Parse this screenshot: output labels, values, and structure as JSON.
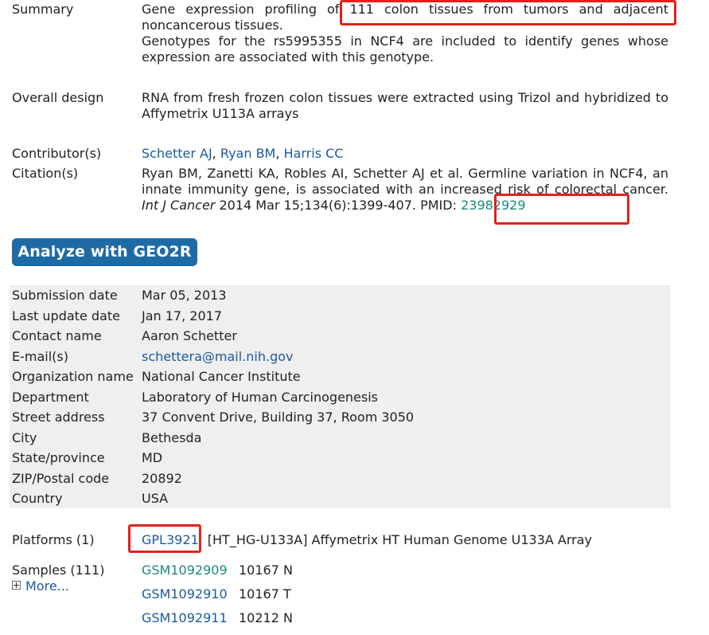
{
  "summary": {
    "label": "Summary",
    "line1_before": "Gene expression profiling of",
    "line1_highlight": "111 colon tissues from tumors and adjacent",
    "line1_after": "noncancerous tissues.",
    "line2": "Genotypes for the rs5995355 in NCF4 are included to identify genes whose expression are associated with this genotype."
  },
  "overall_design": {
    "label": "Overall design",
    "text": "RNA from fresh frozen colon tissues were extracted using Trizol and hybridized to Affymetrix U113A arrays"
  },
  "contributors": {
    "label": "Contributor(s)",
    "names": [
      "Schetter AJ",
      "Ryan BM",
      "Harris CC"
    ],
    "separator": ", "
  },
  "citation": {
    "label": "Citation(s)",
    "text_before": "Ryan BM, Zanetti KA, Robles AI, Schetter AJ et al. Germline variation in NCF4, an innate immunity gene, is associated with an increased risk of colorectal cancer.",
    "journal": "Int J Cancer",
    "text_after": "2014 Mar 15;134(6):1399-407.",
    "pmid_label": "PMID:",
    "pmid": "23982929"
  },
  "geo2r_button": "Analyze with GEO2R",
  "details": [
    {
      "key": "Submission date",
      "value": "Mar 05, 2013"
    },
    {
      "key": "Last update date",
      "value": "Jan 17, 2017"
    },
    {
      "key": "Contact name",
      "value": "Aaron Schetter"
    },
    {
      "key": "E-mail(s)",
      "value": "schettera@mail.nih.gov"
    },
    {
      "key": "Organization name",
      "value": "National Cancer Institute"
    },
    {
      "key": "Department",
      "value": "Laboratory of Human Carcinogenesis"
    },
    {
      "key": "Street address",
      "value": "37 Convent Drive, Building 37, Room 3050"
    },
    {
      "key": "City",
      "value": "Bethesda"
    },
    {
      "key": "State/province",
      "value": "MD"
    },
    {
      "key": "ZIP/Postal code",
      "value": "20892"
    },
    {
      "key": "Country",
      "value": "USA"
    }
  ],
  "platforms": {
    "label": "Platforms (1)",
    "id": "GPL3921",
    "description": "[HT_HG-U133A] Affymetrix HT Human Genome U133A Array"
  },
  "samples": {
    "label": "Samples (111)",
    "more": "More...",
    "items": [
      {
        "id": "GSM1092909",
        "desc": "10167 N"
      },
      {
        "id": "GSM1092910",
        "desc": "10167 T"
      },
      {
        "id": "GSM1092911",
        "desc": "10212 N"
      }
    ]
  },
  "colors": {
    "link": "#1a5a9e",
    "visited_link": "#1a8a7c",
    "button": "#1d6aa5",
    "highlight_box": "#e0221b",
    "table_bg": "#efefef"
  }
}
